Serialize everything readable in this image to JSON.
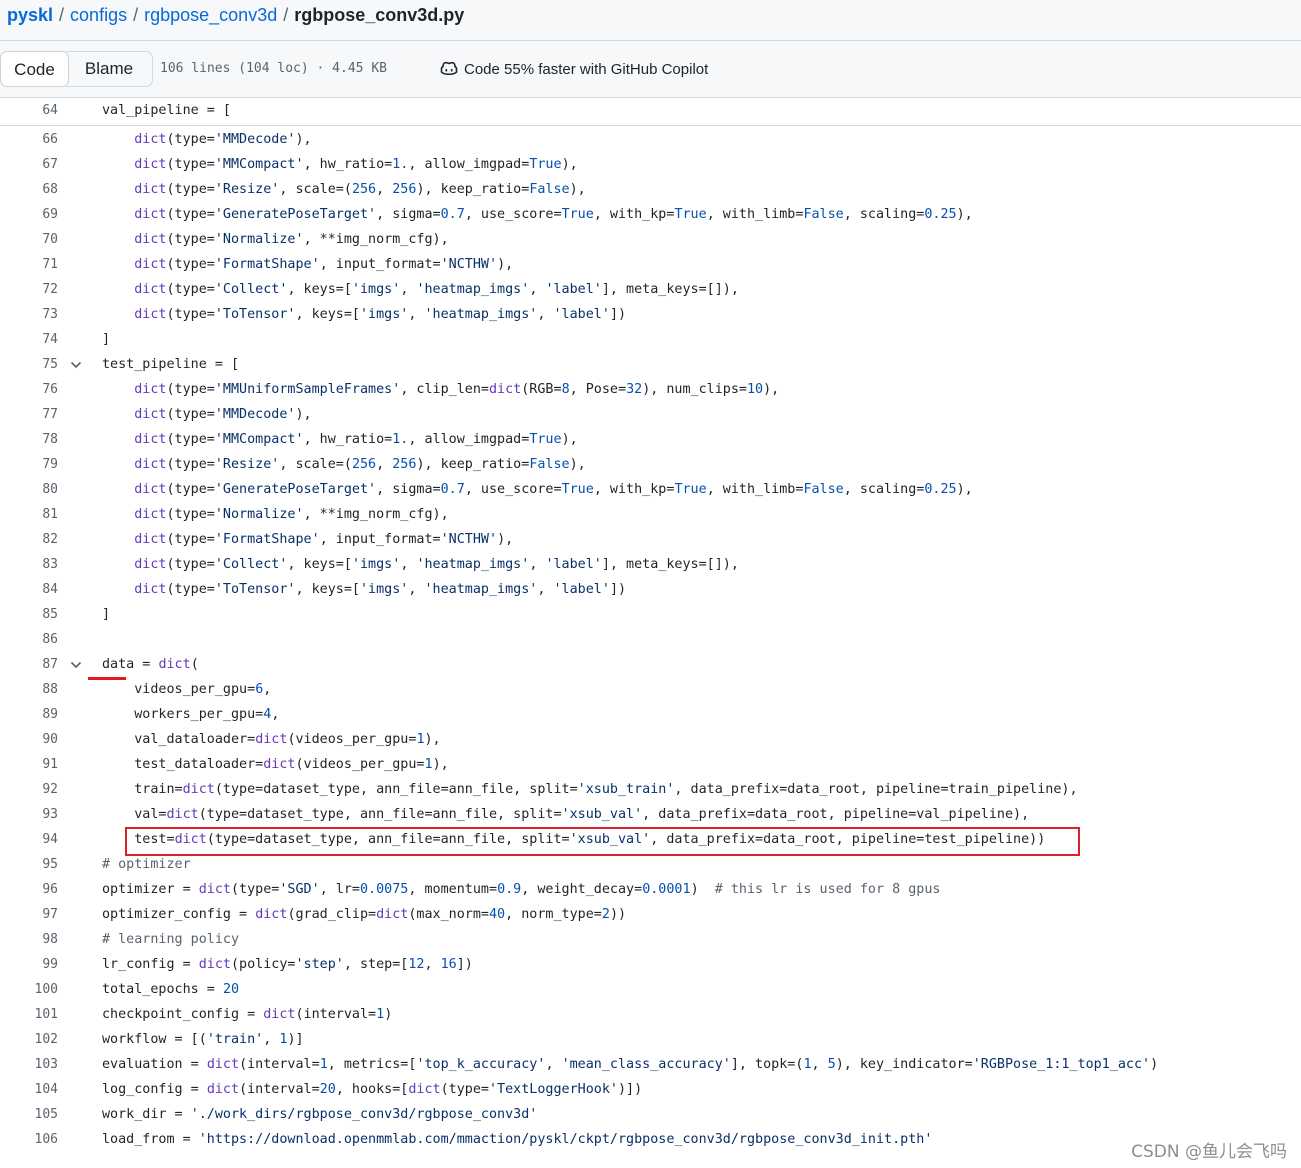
{
  "breadcrumb": {
    "repo": "pyskl",
    "folder1": "configs",
    "folder2": "rgbpose_conv3d",
    "file": "rgbpose_conv3d.py",
    "separator": "/"
  },
  "toolbar": {
    "code_label": "Code",
    "blame_label": "Blame",
    "meta": "106 lines (104 loc) · 4.45 KB",
    "copilot": "Code 55% faster with GitHub Copilot"
  },
  "sticky": {
    "num": "64",
    "code": "val_pipeline = ["
  },
  "lines": [
    {
      "num": "66",
      "fold": false,
      "t": "    <span class=\"k\">dict</span>(type=<span class=\"s\">'MMDecode'</span>),"
    },
    {
      "num": "67",
      "fold": false,
      "t": "    <span class=\"k\">dict</span>(type=<span class=\"s\">'MMCompact'</span>, hw_ratio=<span class=\"n\">1.</span>, allow_imgpad=<span class=\"n\">True</span>),"
    },
    {
      "num": "68",
      "fold": false,
      "t": "    <span class=\"k\">dict</span>(type=<span class=\"s\">'Resize'</span>, scale=(<span class=\"n\">256</span>, <span class=\"n\">256</span>), keep_ratio=<span class=\"n\">False</span>),"
    },
    {
      "num": "69",
      "fold": false,
      "t": "    <span class=\"k\">dict</span>(type=<span class=\"s\">'GeneratePoseTarget'</span>, sigma=<span class=\"n\">0.7</span>, use_score=<span class=\"n\">True</span>, with_kp=<span class=\"n\">True</span>, with_limb=<span class=\"n\">False</span>, scaling=<span class=\"n\">0.25</span>),"
    },
    {
      "num": "70",
      "fold": false,
      "t": "    <span class=\"k\">dict</span>(type=<span class=\"s\">'Normalize'</span>, **img_norm_cfg),"
    },
    {
      "num": "71",
      "fold": false,
      "t": "    <span class=\"k\">dict</span>(type=<span class=\"s\">'FormatShape'</span>, input_format=<span class=\"s\">'NCTHW'</span>),"
    },
    {
      "num": "72",
      "fold": false,
      "t": "    <span class=\"k\">dict</span>(type=<span class=\"s\">'Collect'</span>, keys=[<span class=\"s\">'imgs'</span>, <span class=\"s\">'heatmap_imgs'</span>, <span class=\"s\">'label'</span>], meta_keys=[]),"
    },
    {
      "num": "73",
      "fold": false,
      "t": "    <span class=\"k\">dict</span>(type=<span class=\"s\">'ToTensor'</span>, keys=[<span class=\"s\">'imgs'</span>, <span class=\"s\">'heatmap_imgs'</span>, <span class=\"s\">'label'</span>])"
    },
    {
      "num": "74",
      "fold": false,
      "t": "]"
    },
    {
      "num": "75",
      "fold": true,
      "t": "test_pipeline = ["
    },
    {
      "num": "76",
      "fold": false,
      "t": "    <span class=\"k\">dict</span>(type=<span class=\"s\">'MMUniformSampleFrames'</span>, clip_len=<span class=\"k\">dict</span>(RGB=<span class=\"n\">8</span>, Pose=<span class=\"n\">32</span>), num_clips=<span class=\"n\">10</span>),"
    },
    {
      "num": "77",
      "fold": false,
      "t": "    <span class=\"k\">dict</span>(type=<span class=\"s\">'MMDecode'</span>),"
    },
    {
      "num": "78",
      "fold": false,
      "t": "    <span class=\"k\">dict</span>(type=<span class=\"s\">'MMCompact'</span>, hw_ratio=<span class=\"n\">1.</span>, allow_imgpad=<span class=\"n\">True</span>),"
    },
    {
      "num": "79",
      "fold": false,
      "t": "    <span class=\"k\">dict</span>(type=<span class=\"s\">'Resize'</span>, scale=(<span class=\"n\">256</span>, <span class=\"n\">256</span>), keep_ratio=<span class=\"n\">False</span>),"
    },
    {
      "num": "80",
      "fold": false,
      "t": "    <span class=\"k\">dict</span>(type=<span class=\"s\">'GeneratePoseTarget'</span>, sigma=<span class=\"n\">0.7</span>, use_score=<span class=\"n\">True</span>, with_kp=<span class=\"n\">True</span>, with_limb=<span class=\"n\">False</span>, scaling=<span class=\"n\">0.25</span>),"
    },
    {
      "num": "81",
      "fold": false,
      "t": "    <span class=\"k\">dict</span>(type=<span class=\"s\">'Normalize'</span>, **img_norm_cfg),"
    },
    {
      "num": "82",
      "fold": false,
      "t": "    <span class=\"k\">dict</span>(type=<span class=\"s\">'FormatShape'</span>, input_format=<span class=\"s\">'NCTHW'</span>),"
    },
    {
      "num": "83",
      "fold": false,
      "t": "    <span class=\"k\">dict</span>(type=<span class=\"s\">'Collect'</span>, keys=[<span class=\"s\">'imgs'</span>, <span class=\"s\">'heatmap_imgs'</span>, <span class=\"s\">'label'</span>], meta_keys=[]),"
    },
    {
      "num": "84",
      "fold": false,
      "t": "    <span class=\"k\">dict</span>(type=<span class=\"s\">'ToTensor'</span>, keys=[<span class=\"s\">'imgs'</span>, <span class=\"s\">'heatmap_imgs'</span>, <span class=\"s\">'label'</span>])"
    },
    {
      "num": "85",
      "fold": false,
      "t": "]"
    },
    {
      "num": "86",
      "fold": false,
      "t": ""
    },
    {
      "num": "87",
      "fold": true,
      "t": "data = <span class=\"k\">dict</span>("
    },
    {
      "num": "88",
      "fold": false,
      "t": "    videos_per_gpu=<span class=\"n\">6</span>,"
    },
    {
      "num": "89",
      "fold": false,
      "t": "    workers_per_gpu=<span class=\"n\">4</span>,"
    },
    {
      "num": "90",
      "fold": false,
      "t": "    val_dataloader=<span class=\"k\">dict</span>(videos_per_gpu=<span class=\"n\">1</span>),"
    },
    {
      "num": "91",
      "fold": false,
      "t": "    test_dataloader=<span class=\"k\">dict</span>(videos_per_gpu=<span class=\"n\">1</span>),"
    },
    {
      "num": "92",
      "fold": false,
      "t": "    train=<span class=\"k\">dict</span>(type=dataset_type, ann_file=ann_file, split=<span class=\"s\">'xsub_train'</span>, data_prefix=data_root, pipeline=train_pipeline),"
    },
    {
      "num": "93",
      "fold": false,
      "t": "    val=<span class=\"k\">dict</span>(type=dataset_type, ann_file=ann_file, split=<span class=\"s\">'xsub_val'</span>, data_prefix=data_root, pipeline=val_pipeline),"
    },
    {
      "num": "94",
      "fold": false,
      "t": "    test=<span class=\"k\">dict</span>(type=dataset_type, ann_file=ann_file, split=<span class=\"s\">'xsub_val'</span>, data_prefix=data_root, pipeline=test_pipeline))"
    },
    {
      "num": "95",
      "fold": false,
      "t": "<span class=\"c\"># optimizer</span>"
    },
    {
      "num": "96",
      "fold": false,
      "t": "optimizer = <span class=\"k\">dict</span>(type=<span class=\"s\">'SGD'</span>, lr=<span class=\"n\">0.0075</span>, momentum=<span class=\"n\">0.9</span>, weight_decay=<span class=\"n\">0.0001</span>)  <span class=\"c\"># this lr is used for 8 gpus</span>"
    },
    {
      "num": "97",
      "fold": false,
      "t": "optimizer_config = <span class=\"k\">dict</span>(grad_clip=<span class=\"k\">dict</span>(max_norm=<span class=\"n\">40</span>, norm_type=<span class=\"n\">2</span>))"
    },
    {
      "num": "98",
      "fold": false,
      "t": "<span class=\"c\"># learning policy</span>"
    },
    {
      "num": "99",
      "fold": false,
      "t": "lr_config = <span class=\"k\">dict</span>(policy=<span class=\"s\">'step'</span>, step=[<span class=\"n\">12</span>, <span class=\"n\">16</span>])"
    },
    {
      "num": "100",
      "fold": false,
      "t": "total_epochs = <span class=\"n\">20</span>"
    },
    {
      "num": "101",
      "fold": false,
      "t": "checkpoint_config = <span class=\"k\">dict</span>(interval=<span class=\"n\">1</span>)"
    },
    {
      "num": "102",
      "fold": false,
      "t": "workflow = [(<span class=\"s\">'train'</span>, <span class=\"n\">1</span>)]"
    },
    {
      "num": "103",
      "fold": false,
      "t": "evaluation = <span class=\"k\">dict</span>(interval=<span class=\"n\">1</span>, metrics=[<span class=\"s\">'top_k_accuracy'</span>, <span class=\"s\">'mean_class_accuracy'</span>], topk=(<span class=\"n\">1</span>, <span class=\"n\">5</span>), key_indicator=<span class=\"s\">'RGBPose_1:1_top1_acc'</span>)"
    },
    {
      "num": "104",
      "fold": false,
      "t": "log_config = <span class=\"k\">dict</span>(interval=<span class=\"n\">20</span>, hooks=[<span class=\"k\">dict</span>(type=<span class=\"s\">'TextLoggerHook'</span>)])"
    },
    {
      "num": "105",
      "fold": false,
      "t": "work_dir = <span class=\"s\">'./work_dirs/rgbpose_conv3d/rgbpose_conv3d'</span>"
    },
    {
      "num": "106",
      "fold": false,
      "t": "load_from = <span class=\"s\">'https://download.openmmlab.com/mmaction/pyskl/ckpt/rgbpose_conv3d/rgbpose_conv3d_init.pth'</span>"
    }
  ],
  "watermark": "CSDN @鱼儿会飞吗"
}
